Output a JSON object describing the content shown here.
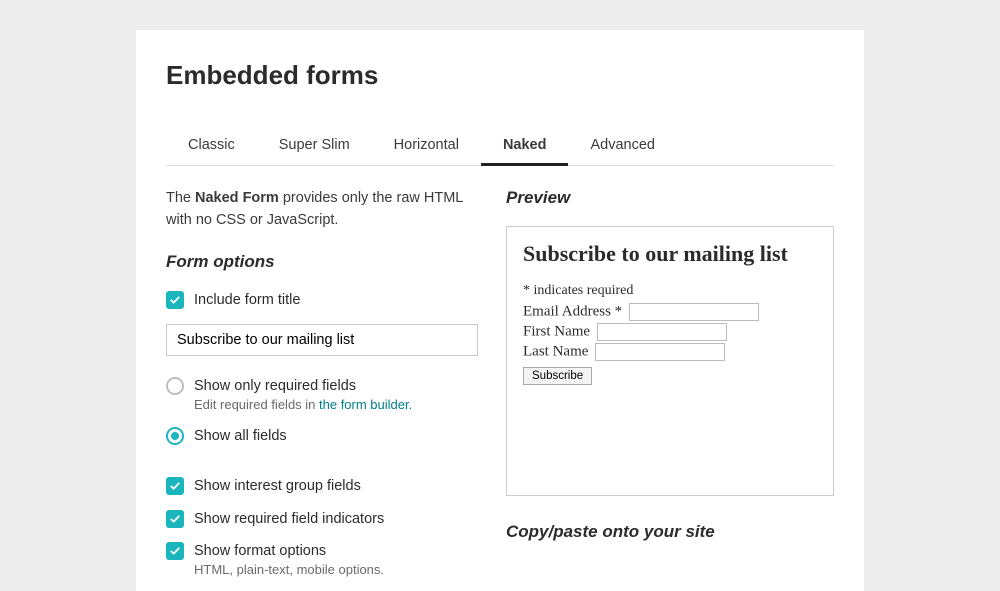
{
  "page_title": "Embedded forms",
  "tabs": [
    "Classic",
    "Super Slim",
    "Horizontal",
    "Naked",
    "Advanced"
  ],
  "active_tab": "Naked",
  "description_prefix": "The ",
  "description_bold": "Naked Form",
  "description_suffix": " provides only the raw HTML with no CSS or JavaScript.",
  "form_options_heading": "Form options",
  "opt_include_title": "Include form title",
  "title_input_value": "Subscribe to our mailing list",
  "opt_required_only": "Show only required fields",
  "opt_required_sub_prefix": "Edit required fields in ",
  "opt_required_sub_link": "the form builder.",
  "opt_show_all": "Show all fields",
  "opt_interest_groups": "Show interest group fields",
  "opt_required_indicators": "Show required field indicators",
  "opt_format": "Show format options",
  "opt_format_sub": "HTML, plain-text, mobile options.",
  "preview_heading": "Preview",
  "copy_heading": "Copy/paste onto your site",
  "preview": {
    "title": "Subscribe to our mailing list",
    "required_note": "* indicates required",
    "email_label": "Email Address *",
    "first_name_label": "First Name",
    "last_name_label": "Last Name",
    "subscribe_btn": "Subscribe"
  }
}
